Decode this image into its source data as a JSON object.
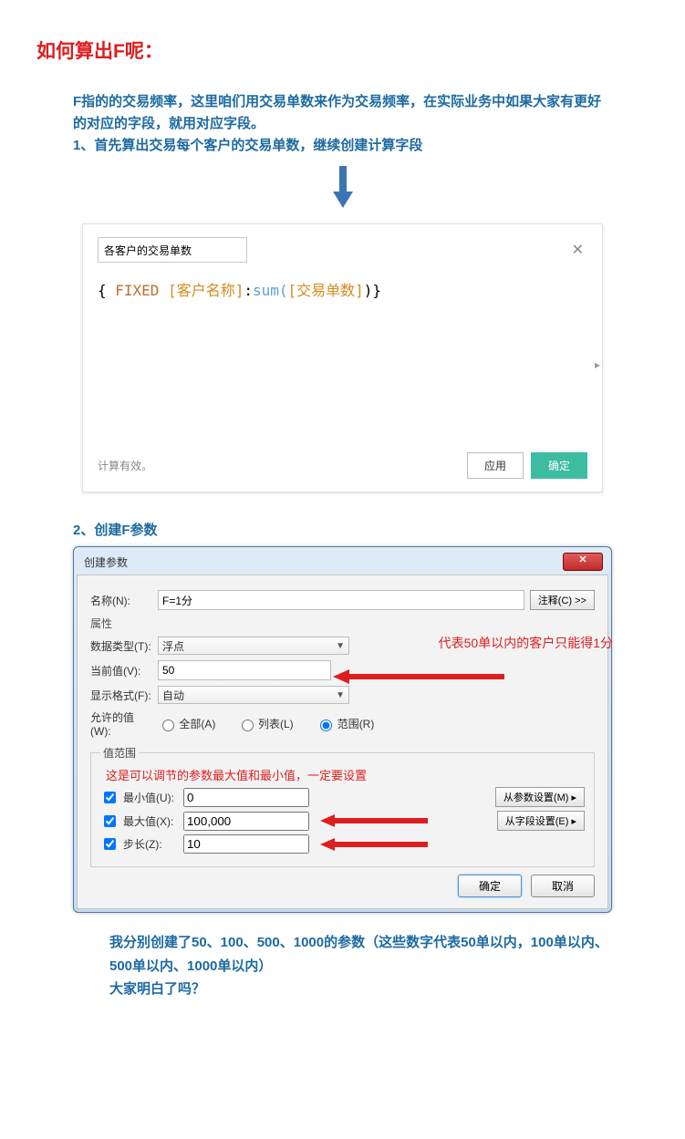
{
  "title": "如何算出F呢：",
  "intro_line1": "F指的的交易频率，这里咱们用交易单数来作为交易频率，在实际业务中如果大家有更好的对应的字段，就用对应字段。",
  "intro_line2": "1、首先算出交易每个客户的交易单数，继续创建计算字段",
  "calc": {
    "field_name": "各客户的交易单数",
    "formula_open": "{ ",
    "formula_fixed": "FIXED ",
    "formula_dim": "[客户名称]",
    "formula_mid": ":",
    "formula_func": "sum(",
    "formula_arg": "[交易单数]",
    "formula_close": ")}",
    "footer_valid": "计算有效。",
    "btn_apply": "应用",
    "btn_ok": "确定"
  },
  "sub2": "2、创建F参数",
  "dlg": {
    "title": "创建参数",
    "name_label": "名称(N):",
    "name_value": "F=1分",
    "comment_btn": "注释(C) >>",
    "group_attr": "属性",
    "datatype_label": "数据类型(T):",
    "datatype_value": "浮点",
    "current_label": "当前值(V):",
    "current_value": "50",
    "display_label": "显示格式(F):",
    "display_value": "自动",
    "allow_label": "允许的值(W):",
    "allow_all": "全部(A)",
    "allow_list": "列表(L)",
    "allow_range": "范围(R)",
    "range_legend": "值范围",
    "range_note": "这是可以调节的参数最大值和最小值，一定要设置",
    "min_label": "最小值(U):",
    "min_value": "0",
    "max_label": "最大值(X):",
    "max_value": "100,000",
    "step_label": "步长(Z):",
    "step_value": "10",
    "from_param_btn": "从参数设置(M)  ▸",
    "from_field_btn": "从字段设置(E)  ▸",
    "ok_btn": "确定",
    "cancel_btn": "取消",
    "red_note_right": "代表50单以内的客户只能得1分"
  },
  "closing1": "我分别创建了50、100、500、1000的参数（这些数字代表50单以内，100单以内、500单以内、1000单以内）",
  "closing2": "大家明白了吗？"
}
